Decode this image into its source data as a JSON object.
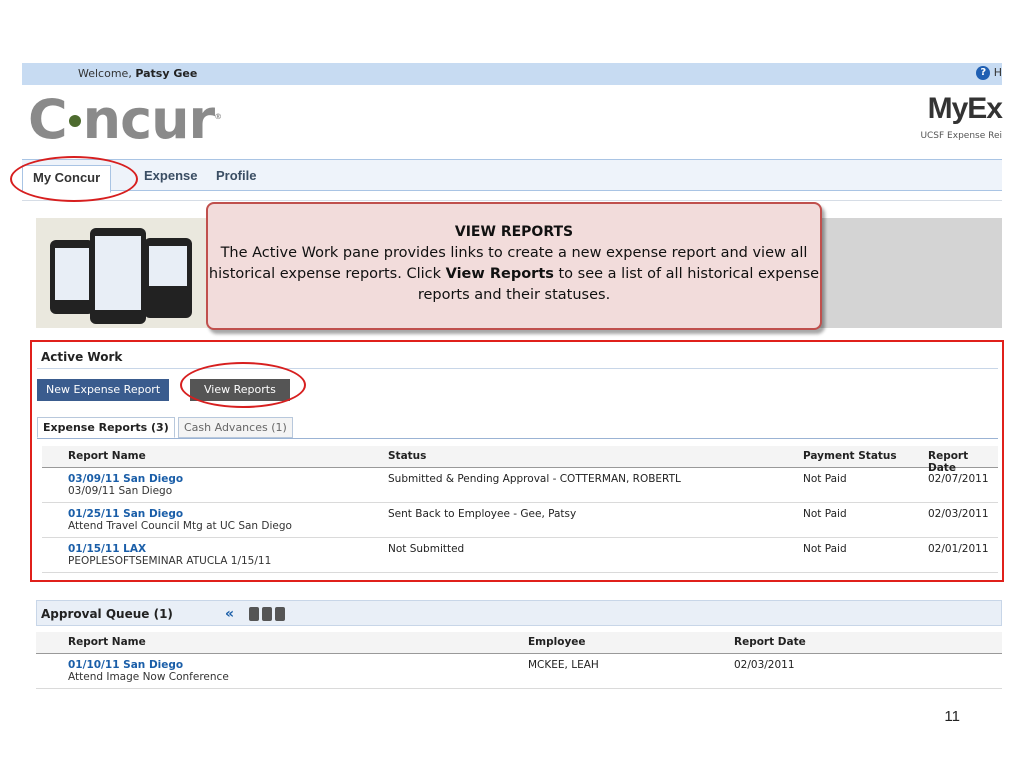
{
  "header": {
    "welcome_prefix": "Welcome,",
    "user_name": "Patsy Gee",
    "help_label": "H",
    "logo_text_1": "C",
    "logo_text_2": "ncur",
    "product_title": "MyEx",
    "product_subtitle": "UCSF Expense Rei"
  },
  "nav": {
    "tabs": [
      {
        "label": "My Concur",
        "active": true
      },
      {
        "label": "Expense",
        "active": false
      },
      {
        "label": "Profile",
        "active": false
      }
    ]
  },
  "callout": {
    "title": "VIEW REPORTS",
    "text_before": "The Active Work pane provides links to create a new expense report and view all historical expense reports. Click ",
    "text_bold": "View Reports",
    "text_after": " to see a list of all historical expense reports and their statuses."
  },
  "active_work": {
    "title": "Active Work",
    "new_button": "New Expense Report",
    "view_button": "View Reports",
    "tabs": [
      "Expense Reports (3)",
      "Cash Advances (1)"
    ],
    "columns": [
      "Report Name",
      "Status",
      "Payment Status",
      "Report Date"
    ],
    "rows": [
      {
        "name": "03/09/11 San Diego",
        "purpose": "03/09/11 San Diego",
        "status": "Submitted & Pending Approval - COTTERMAN, ROBERTL",
        "payment": "Not Paid",
        "date": "02/07/2011"
      },
      {
        "name": "01/25/11 San Diego",
        "purpose": "Attend Travel Council Mtg at UC San Diego",
        "status": "Sent Back to Employee - Gee, Patsy",
        "payment": "Not Paid",
        "date": "02/03/2011"
      },
      {
        "name": "01/15/11 LAX",
        "purpose": "PEOPLESOFTSEMINAR ATUCLA 1/15/11",
        "status": "Not Submitted",
        "payment": "Not Paid",
        "date": "02/01/2011"
      }
    ]
  },
  "approval_queue": {
    "title": "Approval Queue (1)",
    "chevron": "«",
    "columns": [
      "Report Name",
      "Employee",
      "Report Date"
    ],
    "rows": [
      {
        "name": "01/10/11 San Diego",
        "purpose": "Attend Image Now Conference",
        "employee": "MCKEE, LEAH",
        "date": "02/03/2011"
      }
    ]
  },
  "page_number": "11",
  "colors": {
    "accent_blue": "#1a5ea8",
    "highlight_red": "#e0201b",
    "callout_fill": "#f2dcdb",
    "callout_border": "#c0504d"
  }
}
